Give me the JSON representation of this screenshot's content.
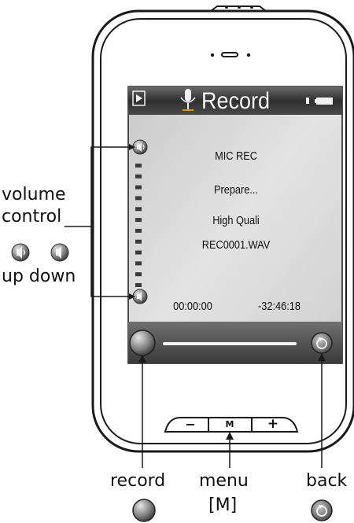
{
  "screen": {
    "title": "Record",
    "lines": [
      "MIC REC",
      "Prepare...",
      "High Quali",
      "REC0001.WAV"
    ],
    "elapsed_time": "00:00:00",
    "remaining_time": "-32:46:18",
    "volume_level_bars": 12
  },
  "buttons": {
    "minus": "−",
    "menu": "M",
    "plus": "+"
  },
  "labels": {
    "volume": "volume",
    "control": "control",
    "up_down": "up down",
    "record": "record",
    "menu": "menu",
    "menu_key": "[M]",
    "back": "back"
  },
  "colors": {
    "screen_bg": "#d6d6d6",
    "title_bar": "#3c3c3c",
    "device_outline": "#1a1a1a"
  }
}
